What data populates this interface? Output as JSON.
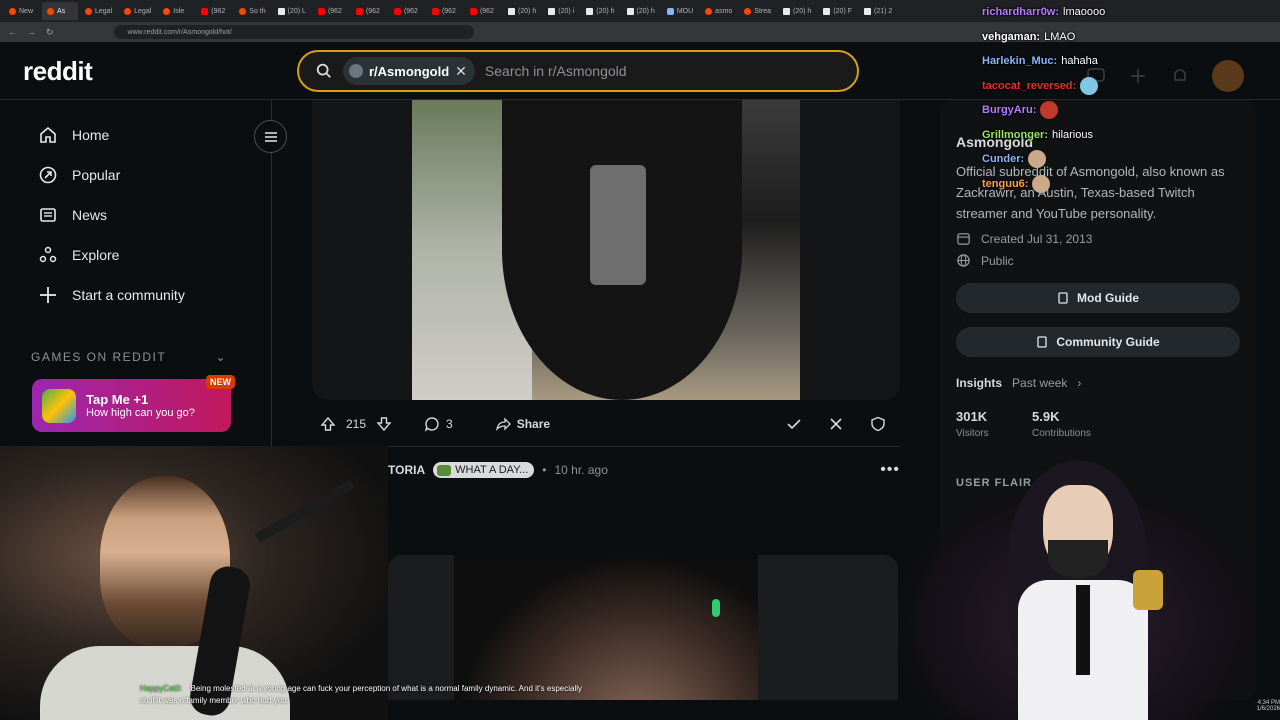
{
  "browser": {
    "tabs": [
      "New",
      "As",
      "Legal",
      "Legal",
      "Isle",
      "(962",
      "So th",
      "(20) L",
      "(962",
      "(962",
      "(962",
      "(962",
      "(962",
      "(20) h",
      "(20) i",
      "(20) h",
      "(20) h",
      "MOU",
      "asmo",
      "Strea",
      "(20) h",
      "(20) F",
      "(21) 2"
    ],
    "url": "www.reddit.com/r/Asmongold/hot/"
  },
  "header": {
    "logo": "reddit",
    "subreddit_chip": "r/Asmongold",
    "search_placeholder": "Search in r/Asmongold"
  },
  "sidebar": {
    "items": [
      {
        "label": "Home",
        "icon": "home-icon"
      },
      {
        "label": "Popular",
        "icon": "popular-icon"
      },
      {
        "label": "News",
        "icon": "news-icon"
      },
      {
        "label": "Explore",
        "icon": "explore-icon"
      },
      {
        "label": "Start a community",
        "icon": "plus-icon"
      }
    ],
    "games_header": "GAMES ON REDDIT",
    "promo": {
      "title": "Tap Me +1",
      "subtitle": "How high can you go?",
      "badge": "NEW"
    }
  },
  "post1": {
    "score": "215",
    "comments": "3",
    "share_label": "Share"
  },
  "post2": {
    "user": "TORIA",
    "flair": "WHAT A DAY...",
    "time": "10 hr. ago"
  },
  "right_sidebar": {
    "title": "Asmongold",
    "description": "Official subreddit of Asmongold, also known as Zackrawrr, an Austin, Texas-based Twitch streamer and YouTube personality.",
    "created": "Created Jul 31, 2013",
    "visibility": "Public",
    "mod_guide": "Mod Guide",
    "community_guide": "Community Guide",
    "insights_title": "Insights",
    "insights_period": "Past week",
    "visitors_value": "301K",
    "visitors_label": "Visitors",
    "contributions_value": "5.9K",
    "contributions_label": "Contributions",
    "user_flair": "USER FLAIR"
  },
  "chat": [
    {
      "user": "richardharr0w:",
      "text": "lmaoooo",
      "color": "#b57bff"
    },
    {
      "user": "vehgaman:",
      "text": "LMAO",
      "color": "#ffffff"
    },
    {
      "user": "Harlekin_Muc:",
      "text": "hahaha",
      "color": "#8ab4f8"
    },
    {
      "user": "tacocat_reversed:",
      "text": "",
      "color": "#e0302a"
    },
    {
      "user": "BurgyAru:",
      "text": "",
      "color": "#b57bff"
    },
    {
      "user": "Grillmonger:",
      "text": "hilarious",
      "color": "#9be36a"
    },
    {
      "user": "Cunder:",
      "text": "",
      "color": "#8ab4f8"
    },
    {
      "user": "tenguu6:",
      "text": "",
      "color": "#ff9f43"
    }
  ],
  "caption": {
    "user": "HappyCat0:",
    "text": "Being molested at a young age can fuck your perception of what is a normal family dynamic. And it's especially so if it was a family member who hurt you"
  },
  "clock": "4:34 PM 1/6/2026"
}
